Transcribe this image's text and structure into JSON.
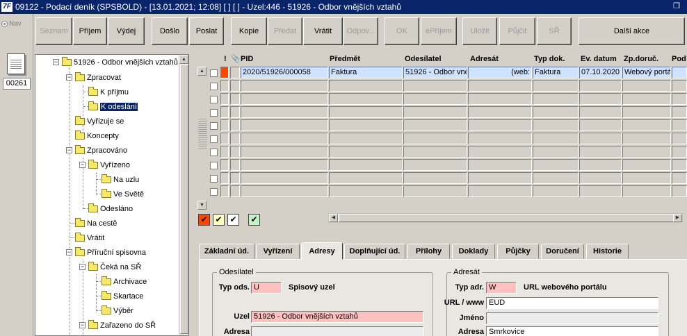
{
  "window": {
    "title": "09122 - Podací deník (SPSBOLD) - [13.01.2021; 12:08]  [ ]  [ ] - Uzel:446 - 51926 - Odbor vnějších vztahů",
    "logo": "7F"
  },
  "rail": {
    "nav_label": "Nav",
    "count_badge": "00261"
  },
  "toolbar": {
    "seznam": "Seznam",
    "prijem": "Příjem",
    "vydej": "Výdej",
    "doslo": "Došlo",
    "poslat": "Poslat",
    "kopie": "Kopie",
    "predat": "Předat",
    "vratit": "Vrátit",
    "odpov": "Odpov...",
    "ok": "OK",
    "eprijem": "ePříjem",
    "ulozit": "Uložit",
    "pujcit": "Půjčit",
    "sr": "SŘ",
    "dalsi": "Další akce"
  },
  "tree": {
    "items": [
      "51926 - Odbor vnějších vztahů",
      "Zpracovat",
      "K příjmu",
      "K odeslání",
      "Vyřizuje se",
      "Koncepty",
      "Zpracováno",
      "Vyřízeno",
      "Na uzlu",
      "Ve Světě",
      "Odesláno",
      "Na cestě",
      "Vrátit",
      "Příruční spisovna",
      "Čeká na SŘ",
      "Archivace",
      "Skartace",
      "Výběr",
      "Zařazeno do SŘ"
    ]
  },
  "grid": {
    "headers": {
      "flag": "!",
      "attach": "@",
      "pid": "PID",
      "predmet": "Předmět",
      "odesilatel": "Odesílatel",
      "adresat": "Adresát",
      "typ": "Typ dok.",
      "ev": "Ev. datum",
      "zp": "Zp.doruč.",
      "po": "Pod"
    },
    "row1": {
      "pid": "2020/51926/000058",
      "predmet": "Faktura",
      "odesilatel": "51926 - Odbor vnějších vztahů",
      "adresat": "(web:",
      "typ": "Faktura",
      "ev": "07.10.2020",
      "zp": "Webový portál"
    }
  },
  "tabs": [
    "Základní úd.",
    "Vyřízení",
    "Adresy",
    "Doplňující úd.",
    "Přílohy",
    "Doklady",
    "Půjčky",
    "Doručení",
    "Historie"
  ],
  "odesilatel": {
    "legend": "Odesílatel",
    "typ_label": "Typ ods.",
    "typ_value": "U",
    "typ_desc": "Spisový uzel",
    "uzel_label": "Uzel",
    "uzel_value": "51926 - Odbor vnějších vztahů",
    "adresa_label": "Adresa"
  },
  "adresat": {
    "legend": "Adresát",
    "typ_label": "Typ adr.",
    "typ_value": "W",
    "typ_desc": "URL webového portálu",
    "url_label": "URL / www",
    "url_value": "EUD",
    "jmeno_label": "Jméno",
    "adresa_label": "Adresa",
    "adresa_value": "Smrkovice"
  },
  "colors": {
    "titlebar": "#0a246a",
    "selection": "#0a246a",
    "required": "#ffc0c0",
    "flag": "#ff4500"
  }
}
